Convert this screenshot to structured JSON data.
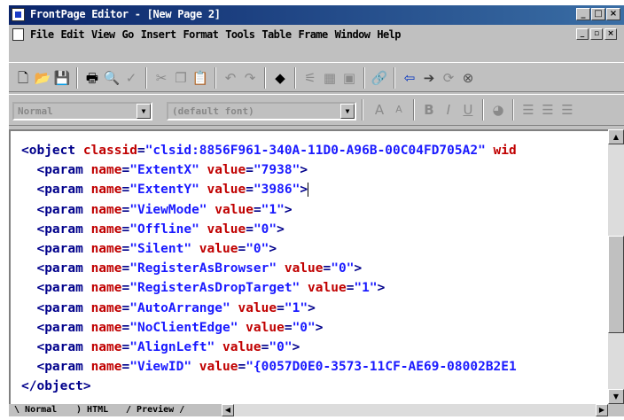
{
  "window": {
    "title": "FrontPage Editor - [New Page 2]"
  },
  "menu": [
    "File",
    "Edit",
    "View",
    "Go",
    "Insert",
    "Format",
    "Tools",
    "Table",
    "Frame",
    "Window",
    "Help"
  ],
  "toolbar": {
    "style_value": "Normal",
    "font_value": "(default font)"
  },
  "code_lines": [
    [
      {
        "t": "<object ",
        "c": "t"
      },
      {
        "t": "classid",
        "c": "a"
      },
      {
        "t": "=",
        "c": "t"
      },
      {
        "t": "\"clsid:8856F961-340A-11D0-A96B-00C04FD705A2\"",
        "c": "v"
      },
      {
        "t": " wid",
        "c": "a"
      }
    ],
    [
      {
        "t": "  <param ",
        "c": "t"
      },
      {
        "t": "name",
        "c": "a"
      },
      {
        "t": "=",
        "c": "t"
      },
      {
        "t": "\"ExtentX\"",
        "c": "v"
      },
      {
        "t": " value",
        "c": "a"
      },
      {
        "t": "=",
        "c": "t"
      },
      {
        "t": "\"7938\"",
        "c": "v"
      },
      {
        "t": ">",
        "c": "t"
      }
    ],
    [
      {
        "t": "  <param ",
        "c": "t"
      },
      {
        "t": "name",
        "c": "a"
      },
      {
        "t": "=",
        "c": "t"
      },
      {
        "t": "\"ExtentY\"",
        "c": "v"
      },
      {
        "t": " value",
        "c": "a"
      },
      {
        "t": "=",
        "c": "t"
      },
      {
        "t": "\"3986\"",
        "c": "v"
      },
      {
        "t": ">",
        "c": "t"
      },
      {
        "t": "",
        "c": "caret"
      }
    ],
    [
      {
        "t": "  <param ",
        "c": "t"
      },
      {
        "t": "name",
        "c": "a"
      },
      {
        "t": "=",
        "c": "t"
      },
      {
        "t": "\"ViewMode\"",
        "c": "v"
      },
      {
        "t": " value",
        "c": "a"
      },
      {
        "t": "=",
        "c": "t"
      },
      {
        "t": "\"1\"",
        "c": "v"
      },
      {
        "t": ">",
        "c": "t"
      }
    ],
    [
      {
        "t": "  <param ",
        "c": "t"
      },
      {
        "t": "name",
        "c": "a"
      },
      {
        "t": "=",
        "c": "t"
      },
      {
        "t": "\"Offline\"",
        "c": "v"
      },
      {
        "t": " value",
        "c": "a"
      },
      {
        "t": "=",
        "c": "t"
      },
      {
        "t": "\"0\"",
        "c": "v"
      },
      {
        "t": ">",
        "c": "t"
      }
    ],
    [
      {
        "t": "  <param ",
        "c": "t"
      },
      {
        "t": "name",
        "c": "a"
      },
      {
        "t": "=",
        "c": "t"
      },
      {
        "t": "\"Silent\"",
        "c": "v"
      },
      {
        "t": " value",
        "c": "a"
      },
      {
        "t": "=",
        "c": "t"
      },
      {
        "t": "\"0\"",
        "c": "v"
      },
      {
        "t": ">",
        "c": "t"
      }
    ],
    [
      {
        "t": "  <param ",
        "c": "t"
      },
      {
        "t": "name",
        "c": "a"
      },
      {
        "t": "=",
        "c": "t"
      },
      {
        "t": "\"RegisterAsBrowser\"",
        "c": "v"
      },
      {
        "t": " value",
        "c": "a"
      },
      {
        "t": "=",
        "c": "t"
      },
      {
        "t": "\"0\"",
        "c": "v"
      },
      {
        "t": ">",
        "c": "t"
      }
    ],
    [
      {
        "t": "  <param ",
        "c": "t"
      },
      {
        "t": "name",
        "c": "a"
      },
      {
        "t": "=",
        "c": "t"
      },
      {
        "t": "\"RegisterAsDropTarget\"",
        "c": "v"
      },
      {
        "t": " value",
        "c": "a"
      },
      {
        "t": "=",
        "c": "t"
      },
      {
        "t": "\"1\"",
        "c": "v"
      },
      {
        "t": ">",
        "c": "t"
      }
    ],
    [
      {
        "t": "  <param ",
        "c": "t"
      },
      {
        "t": "name",
        "c": "a"
      },
      {
        "t": "=",
        "c": "t"
      },
      {
        "t": "\"AutoArrange\"",
        "c": "v"
      },
      {
        "t": " value",
        "c": "a"
      },
      {
        "t": "=",
        "c": "t"
      },
      {
        "t": "\"1\"",
        "c": "v"
      },
      {
        "t": ">",
        "c": "t"
      }
    ],
    [
      {
        "t": "  <param ",
        "c": "t"
      },
      {
        "t": "name",
        "c": "a"
      },
      {
        "t": "=",
        "c": "t"
      },
      {
        "t": "\"NoClientEdge\"",
        "c": "v"
      },
      {
        "t": " value",
        "c": "a"
      },
      {
        "t": "=",
        "c": "t"
      },
      {
        "t": "\"0\"",
        "c": "v"
      },
      {
        "t": ">",
        "c": "t"
      }
    ],
    [
      {
        "t": "  <param ",
        "c": "t"
      },
      {
        "t": "name",
        "c": "a"
      },
      {
        "t": "=",
        "c": "t"
      },
      {
        "t": "\"AlignLeft\"",
        "c": "v"
      },
      {
        "t": " value",
        "c": "a"
      },
      {
        "t": "=",
        "c": "t"
      },
      {
        "t": "\"0\"",
        "c": "v"
      },
      {
        "t": ">",
        "c": "t"
      }
    ],
    [
      {
        "t": "  <param ",
        "c": "t"
      },
      {
        "t": "name",
        "c": "a"
      },
      {
        "t": "=",
        "c": "t"
      },
      {
        "t": "\"ViewID\"",
        "c": "v"
      },
      {
        "t": " value",
        "c": "a"
      },
      {
        "t": "=",
        "c": "t"
      },
      {
        "t": "\"{0057D0E0-3573-11CF-AE69-08002B2E1",
        "c": "v"
      }
    ],
    [
      {
        "t": "</object>",
        "c": "t"
      }
    ]
  ],
  "tabs": [
    "Normal",
    "HTML",
    "Preview"
  ]
}
